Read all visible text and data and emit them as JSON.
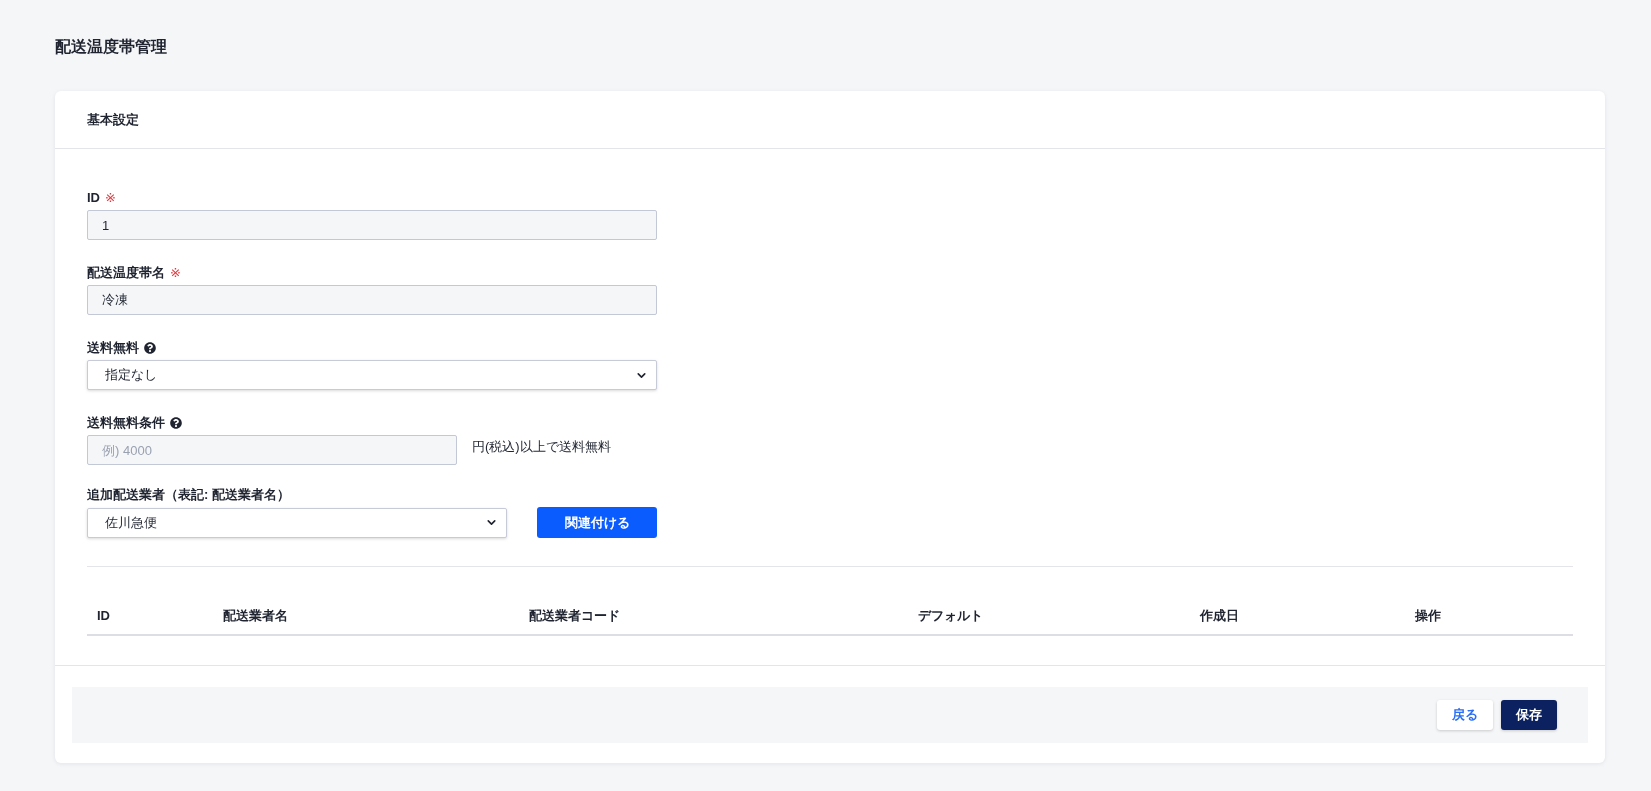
{
  "page": {
    "title": "配送温度帯管理"
  },
  "card": {
    "header": "基本設定",
    "fields": [
      {
        "kind": "text",
        "label": "ID",
        "required_mark": "※",
        "help": false,
        "value": "1"
      },
      {
        "kind": "text",
        "label": "配送温度帯名",
        "required_mark": "※",
        "help": false,
        "value": "冷凍"
      },
      {
        "kind": "select",
        "label": "送料無料",
        "help": true,
        "value": "指定なし"
      },
      {
        "kind": "number",
        "label": "送料無料条件",
        "help": true,
        "placeholder": "例) 4000",
        "suffix": "円(税込)以上で送料無料"
      },
      {
        "kind": "select_button",
        "label": "追加配送業者（表記: 配送業者名）",
        "help": false,
        "value": "佐川急便",
        "button": "関連付ける"
      }
    ],
    "table": {
      "columns": [
        "ID",
        "配送業者名",
        "配送業者コード",
        "デフォルト",
        "作成日",
        "操作"
      ]
    },
    "footer": {
      "buttons": [
        {
          "label": "戻る",
          "kind": "secondary"
        },
        {
          "label": "保存",
          "kind": "primary"
        }
      ]
    }
  }
}
